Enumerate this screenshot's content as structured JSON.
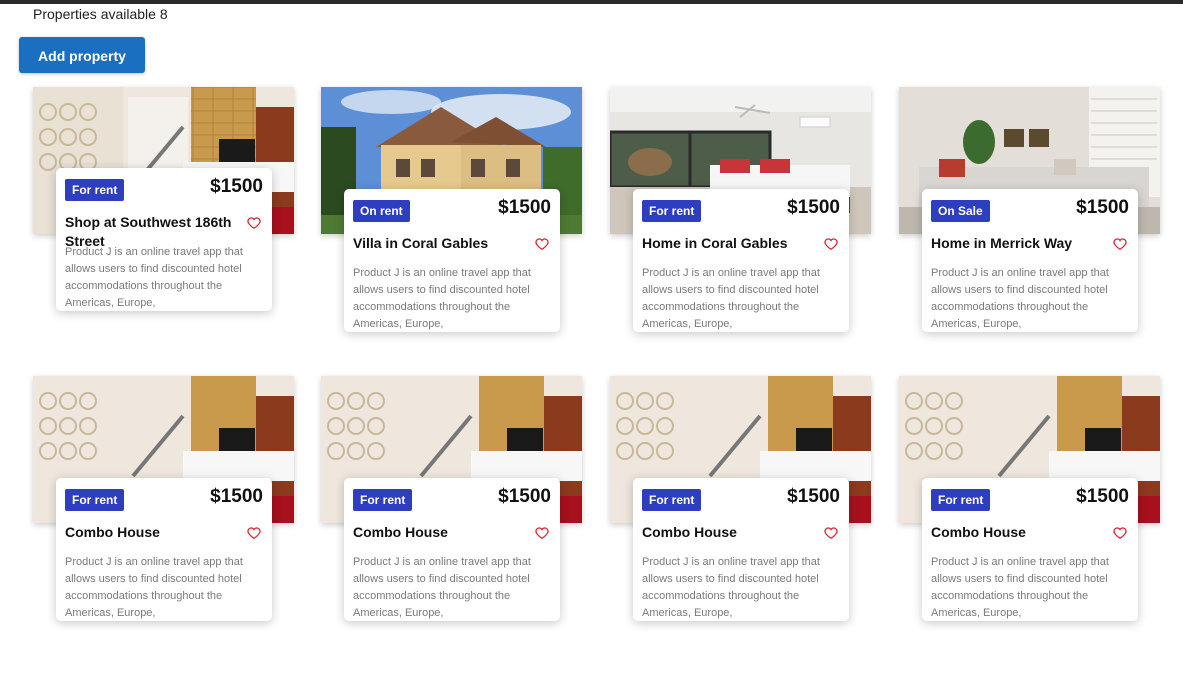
{
  "header": {
    "count_text": "Properties available 8"
  },
  "actions": {
    "add_property_label": "Add property"
  },
  "colors": {
    "primary_button": "#1b6fc0",
    "badge": "#2d3ebf",
    "heart": "#d9232e"
  },
  "cards": [
    {
      "badge": "For rent",
      "price": "$1500",
      "title": "Shop at Southwest 186th Street",
      "description": "Product J is an online travel app that allows users to find discounted hotel accommodations throughout the Americas, Europe,",
      "image": "interior-living-room"
    },
    {
      "badge": "On rent",
      "price": "$1500",
      "title": "Villa in Coral Gables",
      "description": "Product J is an online travel app that allows users to find discounted hotel accommodations throughout the Americas, Europe,",
      "image": "house-exterior"
    },
    {
      "badge": "For rent",
      "price": "$1500",
      "title": "Home in Coral Gables",
      "description": "Product J is an online travel app that allows users to find discounted hotel accommodations throughout the Americas, Europe,",
      "image": "bedroom"
    },
    {
      "badge": "On Sale",
      "price": "$1500",
      "title": "Home in Merrick Way",
      "description": "Product J is an online travel app that allows users to find discounted hotel accommodations throughout the Americas, Europe,",
      "image": "living-room-sofa"
    },
    {
      "badge": "For rent",
      "price": "$1500",
      "title": "Combo House",
      "description": "Product J is an online travel app that allows users to find discounted hotel accommodations throughout the Americas, Europe,",
      "image": "interior-living-room"
    },
    {
      "badge": "For rent",
      "price": "$1500",
      "title": "Combo House",
      "description": "Product J is an online travel app that allows users to find discounted hotel accommodations throughout the Americas, Europe,",
      "image": "interior-living-room"
    },
    {
      "badge": "For rent",
      "price": "$1500",
      "title": "Combo House",
      "description": "Product J is an online travel app that allows users to find discounted hotel accommodations throughout the Americas, Europe,",
      "image": "interior-living-room"
    },
    {
      "badge": "For rent",
      "price": "$1500",
      "title": "Combo House",
      "description": "Product J is an online travel app that allows users to find discounted hotel accommodations throughout the Americas, Europe,",
      "image": "interior-living-room"
    }
  ]
}
